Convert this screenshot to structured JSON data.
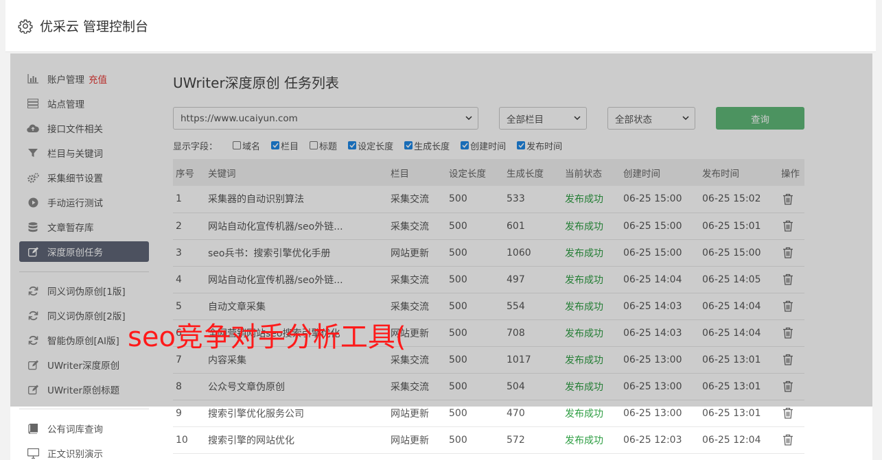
{
  "app": {
    "title": "优采云 管理控制台"
  },
  "sidebar": {
    "items": [
      {
        "label": "账户管理",
        "icon": "bar-chart-icon"
      },
      {
        "label": "站点管理",
        "icon": "server-icon"
      },
      {
        "label": "接口文件相关",
        "icon": "cloud-upload-icon"
      },
      {
        "label": "栏目与关键词",
        "icon": "filter-icon"
      },
      {
        "label": "采集细节设置",
        "icon": "gears-icon"
      },
      {
        "label": "手动运行测试",
        "icon": "play-circle-icon"
      },
      {
        "label": "文章暂存库",
        "icon": "database-icon"
      },
      {
        "label": "深度原创任务",
        "icon": "edit-icon"
      },
      {
        "label": "同义词伪原创[1版]",
        "icon": "refresh-icon"
      },
      {
        "label": "同义词伪原创[2版]",
        "icon": "refresh-icon"
      },
      {
        "label": "智能伪原创[AI版]",
        "icon": "refresh-icon"
      },
      {
        "label": "UWriter深度原创",
        "icon": "edit-icon"
      },
      {
        "label": "UWriter原创标题",
        "icon": "edit-icon"
      },
      {
        "label": "公有词库查询",
        "icon": "book-icon"
      },
      {
        "label": "正文识别演示",
        "icon": "monitor-icon"
      }
    ],
    "recharge": "充值"
  },
  "main": {
    "title": "UWriter深度原创 任务列表",
    "site_select": "https://www.ucaiyun.com",
    "column_select": "全部栏目",
    "status_select": "全部状态",
    "query_label": "查询",
    "fields_label": "显示字段：",
    "fields": [
      {
        "label": "域名",
        "checked": false
      },
      {
        "label": "栏目",
        "checked": true
      },
      {
        "label": "标题",
        "checked": false
      },
      {
        "label": "设定长度",
        "checked": true
      },
      {
        "label": "生成长度",
        "checked": true
      },
      {
        "label": "创建时间",
        "checked": true
      },
      {
        "label": "发布时间",
        "checked": true
      }
    ]
  },
  "table": {
    "headers": [
      "序号",
      "关键词",
      "栏目",
      "设定长度",
      "生成长度",
      "当前状态",
      "创建时间",
      "发布时间",
      "操作"
    ],
    "rows": [
      [
        "1",
        "采集器的自动识别算法",
        "采集交流",
        "500",
        "533",
        "发布成功",
        "06-25 15:00",
        "06-25 15:02"
      ],
      [
        "2",
        "网站自动化宣传机器/seo外链...",
        "采集交流",
        "500",
        "601",
        "发布成功",
        "06-25 15:00",
        "06-25 15:01"
      ],
      [
        "3",
        "seo兵书：搜索引擎优化手册",
        "网站更新",
        "500",
        "1060",
        "发布成功",
        "06-25 15:00",
        "06-25 15:00"
      ],
      [
        "4",
        "网站自动化宣传机器/seo外链...",
        "采集交流",
        "500",
        "497",
        "发布成功",
        "06-25 14:04",
        "06-25 14:05"
      ],
      [
        "5",
        "自动文章采集",
        "采集交流",
        "500",
        "554",
        "发布成功",
        "06-25 14:03",
        "06-25 14:04"
      ],
      [
        "6",
        "全网营销网站seo搜索引擎优化",
        "网站更新",
        "500",
        "708",
        "发布成功",
        "06-25 14:03",
        "06-25 14:04"
      ],
      [
        "7",
        "内容采集",
        "采集交流",
        "500",
        "1017",
        "发布成功",
        "06-25 13:00",
        "06-25 13:01"
      ],
      [
        "8",
        "公众号文章伪原创",
        "采集交流",
        "500",
        "504",
        "发布成功",
        "06-25 13:00",
        "06-25 13:01"
      ],
      [
        "9",
        "搜索引擎优化服务公司",
        "网站更新",
        "500",
        "470",
        "发布成功",
        "06-25 13:00",
        "06-25 13:01"
      ],
      [
        "10",
        "搜索引擎的网站优化",
        "网站更新",
        "500",
        "572",
        "发布成功",
        "06-25 12:03",
        "06-25 12:04"
      ]
    ]
  },
  "watermark": "seo竞争对手分析工具(",
  "colors": {
    "success": "#2e9e43",
    "primary_button": "#5fb878",
    "active_nav": "#5f6677",
    "recharge": "#e53935"
  }
}
